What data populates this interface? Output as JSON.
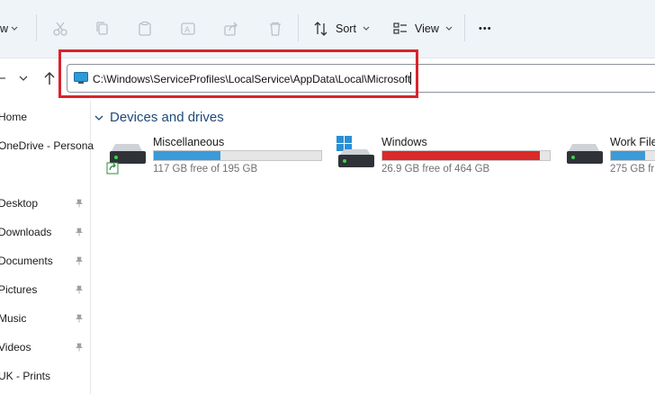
{
  "toolbar": {
    "view_partial": "w",
    "sort_label": "Sort",
    "view_label": "View",
    "more_label": "•••"
  },
  "address": {
    "path": "C:\\Windows\\ServiceProfiles\\LocalService\\AppData\\Local\\Microsoft"
  },
  "sidebar": {
    "items": [
      {
        "label": "Home"
      },
      {
        "label": "OneDrive - Persona"
      },
      {
        "label": "Desktop"
      },
      {
        "label": "Downloads"
      },
      {
        "label": "Documents"
      },
      {
        "label": "Pictures"
      },
      {
        "label": "Music"
      },
      {
        "label": "Videos"
      },
      {
        "label": "UK - Prints"
      }
    ]
  },
  "section": {
    "title": "Devices and drives"
  },
  "drives": [
    {
      "name": "Miscellaneous",
      "free": "117 GB free of 195 GB",
      "used_fraction": 0.4,
      "color": "#3a9bd9"
    },
    {
      "name": "Windows",
      "free": "26.9 GB free of 464 GB",
      "used_fraction": 0.94,
      "color": "#da2a2a"
    },
    {
      "name": "Work File",
      "free": "275 GB fr",
      "used_fraction": 0.2,
      "color": "#3a9bd9"
    }
  ],
  "colors": {
    "accent": "#3a9bd9",
    "danger": "#da2a2a",
    "highlight": "#d9232d",
    "toolbar_bg": "#eff4f9"
  }
}
